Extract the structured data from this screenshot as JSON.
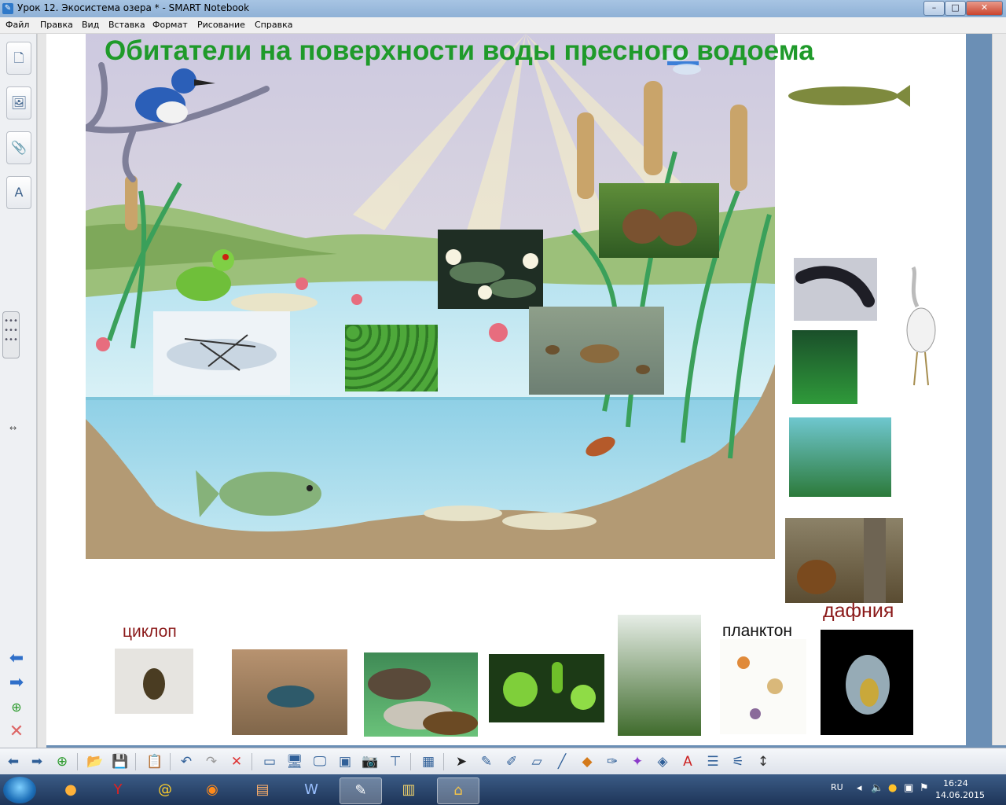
{
  "window": {
    "title": "Урок 12. Экосистема озера * - SMART Notebook",
    "minimize": "–",
    "maximize": "□",
    "close": "✕"
  },
  "menu": {
    "items": [
      "Файл",
      "Правка",
      "Вид",
      "Вставка",
      "Формат",
      "Рисование",
      "Справка"
    ]
  },
  "slide": {
    "title": "Обитатели на поверхности  воды пресного водоема",
    "labels": {
      "cyclops": "циклоп",
      "plankton": "планктон",
      "daphnia": "дафния"
    }
  },
  "taskbar": {
    "lang": "RU",
    "time": "16:24",
    "date": "14.06.2015"
  },
  "colors": {
    "title_green": "#1f9a2a",
    "label_darkred": "#8b1a1a",
    "water": "#a9dcea",
    "sky": "#dcdcea"
  },
  "icons": [
    "page-sorter-icon",
    "gallery-icon",
    "attachments-icon",
    "properties-icon",
    "back-arrow-icon",
    "forward-arrow-icon",
    "add-page-icon",
    "delete-page-icon"
  ]
}
